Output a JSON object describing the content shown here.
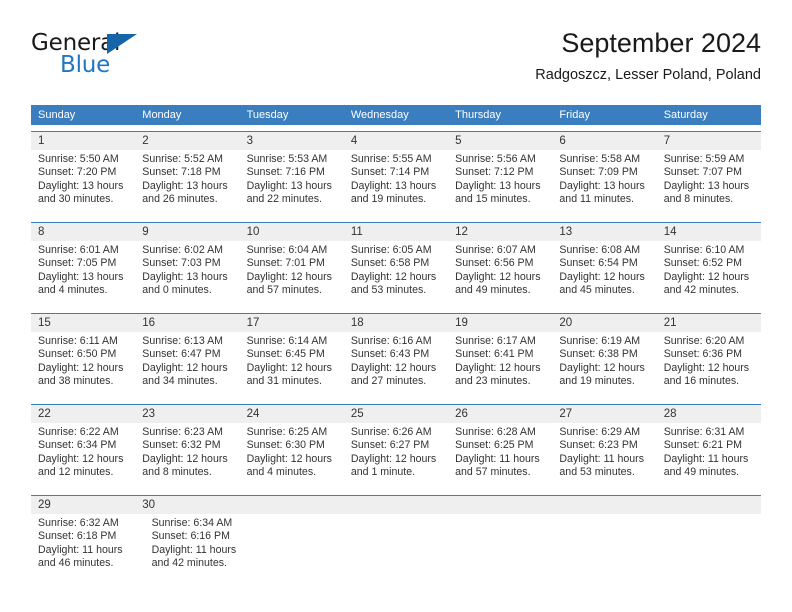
{
  "brand": {
    "name_part1": "General",
    "name_part2": "Blue",
    "flag_icon": "triangle-flag-icon",
    "accent_color": "#1f77c4"
  },
  "header": {
    "title": "September 2024",
    "location": "Radgoszcz, Lesser Poland, Poland"
  },
  "colors": {
    "header_blue": "#3a7ebf",
    "number_band": "#efefef",
    "text": "#333333"
  },
  "weekdays": [
    "Sunday",
    "Monday",
    "Tuesday",
    "Wednesday",
    "Thursday",
    "Friday",
    "Saturday"
  ],
  "weeks": [
    {
      "days": [
        {
          "num": "1",
          "sunrise": "Sunrise: 5:50 AM",
          "sunset": "Sunset: 7:20 PM",
          "daylight1": "Daylight: 13 hours",
          "daylight2": "and 30 minutes."
        },
        {
          "num": "2",
          "sunrise": "Sunrise: 5:52 AM",
          "sunset": "Sunset: 7:18 PM",
          "daylight1": "Daylight: 13 hours",
          "daylight2": "and 26 minutes."
        },
        {
          "num": "3",
          "sunrise": "Sunrise: 5:53 AM",
          "sunset": "Sunset: 7:16 PM",
          "daylight1": "Daylight: 13 hours",
          "daylight2": "and 22 minutes."
        },
        {
          "num": "4",
          "sunrise": "Sunrise: 5:55 AM",
          "sunset": "Sunset: 7:14 PM",
          "daylight1": "Daylight: 13 hours",
          "daylight2": "and 19 minutes."
        },
        {
          "num": "5",
          "sunrise": "Sunrise: 5:56 AM",
          "sunset": "Sunset: 7:12 PM",
          "daylight1": "Daylight: 13 hours",
          "daylight2": "and 15 minutes."
        },
        {
          "num": "6",
          "sunrise": "Sunrise: 5:58 AM",
          "sunset": "Sunset: 7:09 PM",
          "daylight1": "Daylight: 13 hours",
          "daylight2": "and 11 minutes."
        },
        {
          "num": "7",
          "sunrise": "Sunrise: 5:59 AM",
          "sunset": "Sunset: 7:07 PM",
          "daylight1": "Daylight: 13 hours",
          "daylight2": "and 8 minutes."
        }
      ]
    },
    {
      "days": [
        {
          "num": "8",
          "sunrise": "Sunrise: 6:01 AM",
          "sunset": "Sunset: 7:05 PM",
          "daylight1": "Daylight: 13 hours",
          "daylight2": "and 4 minutes."
        },
        {
          "num": "9",
          "sunrise": "Sunrise: 6:02 AM",
          "sunset": "Sunset: 7:03 PM",
          "daylight1": "Daylight: 13 hours",
          "daylight2": "and 0 minutes."
        },
        {
          "num": "10",
          "sunrise": "Sunrise: 6:04 AM",
          "sunset": "Sunset: 7:01 PM",
          "daylight1": "Daylight: 12 hours",
          "daylight2": "and 57 minutes."
        },
        {
          "num": "11",
          "sunrise": "Sunrise: 6:05 AM",
          "sunset": "Sunset: 6:58 PM",
          "daylight1": "Daylight: 12 hours",
          "daylight2": "and 53 minutes."
        },
        {
          "num": "12",
          "sunrise": "Sunrise: 6:07 AM",
          "sunset": "Sunset: 6:56 PM",
          "daylight1": "Daylight: 12 hours",
          "daylight2": "and 49 minutes."
        },
        {
          "num": "13",
          "sunrise": "Sunrise: 6:08 AM",
          "sunset": "Sunset: 6:54 PM",
          "daylight1": "Daylight: 12 hours",
          "daylight2": "and 45 minutes."
        },
        {
          "num": "14",
          "sunrise": "Sunrise: 6:10 AM",
          "sunset": "Sunset: 6:52 PM",
          "daylight1": "Daylight: 12 hours",
          "daylight2": "and 42 minutes."
        }
      ]
    },
    {
      "days": [
        {
          "num": "15",
          "sunrise": "Sunrise: 6:11 AM",
          "sunset": "Sunset: 6:50 PM",
          "daylight1": "Daylight: 12 hours",
          "daylight2": "and 38 minutes."
        },
        {
          "num": "16",
          "sunrise": "Sunrise: 6:13 AM",
          "sunset": "Sunset: 6:47 PM",
          "daylight1": "Daylight: 12 hours",
          "daylight2": "and 34 minutes."
        },
        {
          "num": "17",
          "sunrise": "Sunrise: 6:14 AM",
          "sunset": "Sunset: 6:45 PM",
          "daylight1": "Daylight: 12 hours",
          "daylight2": "and 31 minutes."
        },
        {
          "num": "18",
          "sunrise": "Sunrise: 6:16 AM",
          "sunset": "Sunset: 6:43 PM",
          "daylight1": "Daylight: 12 hours",
          "daylight2": "and 27 minutes."
        },
        {
          "num": "19",
          "sunrise": "Sunrise: 6:17 AM",
          "sunset": "Sunset: 6:41 PM",
          "daylight1": "Daylight: 12 hours",
          "daylight2": "and 23 minutes."
        },
        {
          "num": "20",
          "sunrise": "Sunrise: 6:19 AM",
          "sunset": "Sunset: 6:38 PM",
          "daylight1": "Daylight: 12 hours",
          "daylight2": "and 19 minutes."
        },
        {
          "num": "21",
          "sunrise": "Sunrise: 6:20 AM",
          "sunset": "Sunset: 6:36 PM",
          "daylight1": "Daylight: 12 hours",
          "daylight2": "and 16 minutes."
        }
      ]
    },
    {
      "days": [
        {
          "num": "22",
          "sunrise": "Sunrise: 6:22 AM",
          "sunset": "Sunset: 6:34 PM",
          "daylight1": "Daylight: 12 hours",
          "daylight2": "and 12 minutes."
        },
        {
          "num": "23",
          "sunrise": "Sunrise: 6:23 AM",
          "sunset": "Sunset: 6:32 PM",
          "daylight1": "Daylight: 12 hours",
          "daylight2": "and 8 minutes."
        },
        {
          "num": "24",
          "sunrise": "Sunrise: 6:25 AM",
          "sunset": "Sunset: 6:30 PM",
          "daylight1": "Daylight: 12 hours",
          "daylight2": "and 4 minutes."
        },
        {
          "num": "25",
          "sunrise": "Sunrise: 6:26 AM",
          "sunset": "Sunset: 6:27 PM",
          "daylight1": "Daylight: 12 hours",
          "daylight2": "and 1 minute."
        },
        {
          "num": "26",
          "sunrise": "Sunrise: 6:28 AM",
          "sunset": "Sunset: 6:25 PM",
          "daylight1": "Daylight: 11 hours",
          "daylight2": "and 57 minutes."
        },
        {
          "num": "27",
          "sunrise": "Sunrise: 6:29 AM",
          "sunset": "Sunset: 6:23 PM",
          "daylight1": "Daylight: 11 hours",
          "daylight2": "and 53 minutes."
        },
        {
          "num": "28",
          "sunrise": "Sunrise: 6:31 AM",
          "sunset": "Sunset: 6:21 PM",
          "daylight1": "Daylight: 11 hours",
          "daylight2": "and 49 minutes."
        }
      ]
    },
    {
      "days": [
        {
          "num": "29",
          "sunrise": "Sunrise: 6:32 AM",
          "sunset": "Sunset: 6:18 PM",
          "daylight1": "Daylight: 11 hours",
          "daylight2": "and 46 minutes."
        },
        {
          "num": "30",
          "sunrise": "Sunrise: 6:34 AM",
          "sunset": "Sunset: 6:16 PM",
          "daylight1": "Daylight: 11 hours",
          "daylight2": "and 42 minutes."
        },
        {
          "num": "",
          "sunrise": "",
          "sunset": "",
          "daylight1": "",
          "daylight2": ""
        },
        {
          "num": "",
          "sunrise": "",
          "sunset": "",
          "daylight1": "",
          "daylight2": ""
        },
        {
          "num": "",
          "sunrise": "",
          "sunset": "",
          "daylight1": "",
          "daylight2": ""
        },
        {
          "num": "",
          "sunrise": "",
          "sunset": "",
          "daylight1": "",
          "daylight2": ""
        },
        {
          "num": "",
          "sunrise": "",
          "sunset": "",
          "daylight1": "",
          "daylight2": ""
        }
      ]
    }
  ]
}
